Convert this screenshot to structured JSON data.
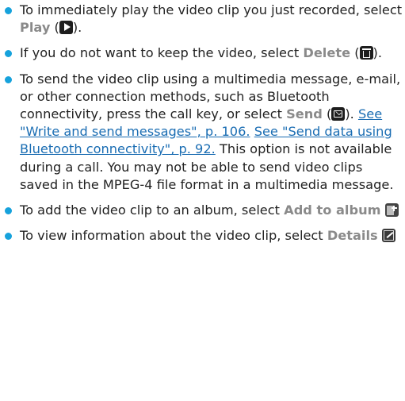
{
  "items": [
    {
      "pre": "To immediately play the video clip you just recorded, select ",
      "command": "Play",
      "open": " (",
      "close": ").",
      "icon": "play-icon"
    },
    {
      "pre": "If you do not want to keep the video, select ",
      "command": "Delete",
      "open": " (",
      "close": ").",
      "icon": "trash-icon"
    },
    {
      "pre": "To send the video clip using a multimedia message, e-mail, or other connection methods, such as Bluetooth connectivity, press the call key, or select ",
      "command": "Send",
      "open": " (",
      "close": "). ",
      "icon": "envelope-icon",
      "link1": "See \"Write and send messages\", p. 106.",
      "link2": "See \"Send data using Bluetooth connectivity\", p. 92.",
      "post": " This option is not available during a call. You may not be able to send video clips saved in the MPEG-4 file format in a multimedia message."
    },
    {
      "pre": "To add the video clip to an album, select ",
      "command": "Add to album",
      "icon": "add-to-album-icon"
    },
    {
      "pre": "To view information about the video clip, select ",
      "command": "Details",
      "icon": "details-icon"
    }
  ],
  "colors": {
    "bullet": "#16a2dc",
    "command": "#8a8a8a",
    "link": "#1a6db3",
    "text": "#222222"
  }
}
